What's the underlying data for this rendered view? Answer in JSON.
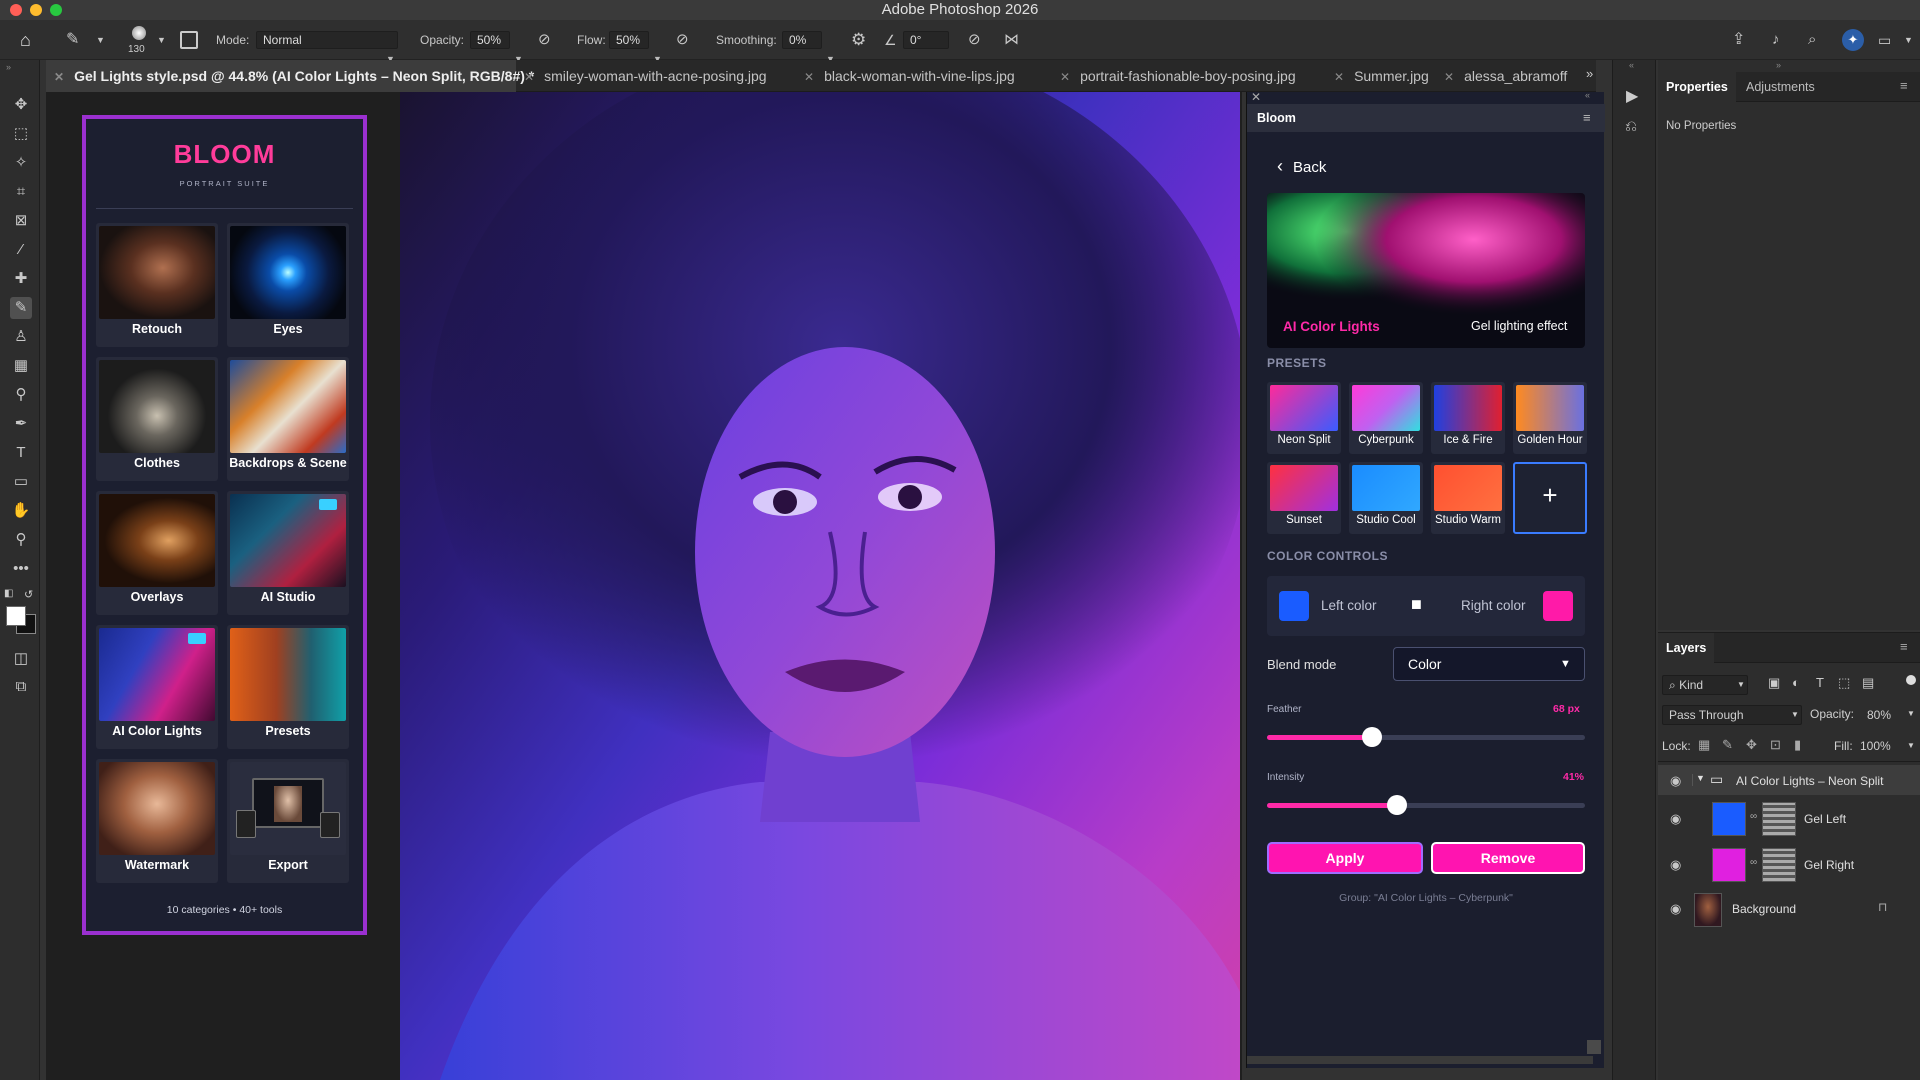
{
  "app": {
    "title": "Adobe Photoshop 2026"
  },
  "options_bar": {
    "brush_size": "130",
    "mode_label": "Mode:",
    "mode_value": "Normal",
    "opacity_label": "Opacity:",
    "opacity_value": "50%",
    "flow_label": "Flow:",
    "flow_value": "50%",
    "smoothing_label": "Smoothing:",
    "smoothing_value": "0%",
    "angle_value": "0°"
  },
  "tabs": [
    {
      "label": "Gel Lights style.psd @ 44.8% (AI Color Lights – Neon Split, RGB/8#) *"
    },
    {
      "label": "smiley-woman-with-acne-posing.jpg"
    },
    {
      "label": "black-woman-with-vine-lips.jpg"
    },
    {
      "label": "portrait-fashionable-boy-posing.jpg"
    },
    {
      "label": "Summer.jpg"
    },
    {
      "label": "alessa_abramoff"
    }
  ],
  "bloom_grid": {
    "logo": "BLOOM",
    "tagline": "PORTRAIT SUITE",
    "cards": [
      {
        "label": "Retouch"
      },
      {
        "label": "Eyes"
      },
      {
        "label": "Clothes"
      },
      {
        "label": "Backdrops & Scene"
      },
      {
        "label": "Overlays"
      },
      {
        "label": "AI Studio"
      },
      {
        "label": "AI Color Lights"
      },
      {
        "label": "Presets"
      },
      {
        "label": "Watermark"
      },
      {
        "label": "Export"
      }
    ],
    "footer": "10 categories • 40+ tools"
  },
  "plugin": {
    "header": "Bloom",
    "back": "Back",
    "hero_title": "AI Color Lights",
    "hero_sub": "Gel lighting effect",
    "presets_heading": "PRESETS",
    "presets": [
      {
        "label": "Neon Split"
      },
      {
        "label": "Cyberpunk"
      },
      {
        "label": "Ice & Fire"
      },
      {
        "label": "Golden Hour"
      },
      {
        "label": "Sunset"
      },
      {
        "label": "Studio Cool"
      },
      {
        "label": "Studio Warm"
      }
    ],
    "add_preset_symbol": "+",
    "color_controls_heading": "COLOR CONTROLS",
    "left_color_label": "Left color",
    "left_color": "#1a5cff",
    "right_color_label": "Right color",
    "right_color": "#ff1aa8",
    "blend_mode_label": "Blend mode",
    "blend_mode_value": "Color",
    "feather_label": "Feather",
    "feather_value": "68 px",
    "feather_fraction": 0.33,
    "intensity_label": "Intensity",
    "intensity_value": "41%",
    "intensity_fraction": 0.41,
    "apply_label": "Apply",
    "remove_label": "Remove",
    "group_note": "Group: \"AI Color Lights – Cyberpunk\""
  },
  "properties_panel": {
    "tab_properties": "Properties",
    "tab_adjustments": "Adjustments",
    "empty_text": "No Properties"
  },
  "layers_panel": {
    "title": "Layers",
    "kind_label": "Kind",
    "blend_value": "Pass Through",
    "opacity_label": "Opacity:",
    "opacity_value": "80%",
    "lock_label": "Lock:",
    "fill_label": "Fill:",
    "fill_value": "100%",
    "layers": [
      {
        "name": "AI Color Lights – Neon Split"
      },
      {
        "name": "Gel Left"
      },
      {
        "name": "Gel Right"
      },
      {
        "name": "Background"
      }
    ]
  },
  "colors": {
    "accent_magenta": "#ff1aa8",
    "accent_purple": "#9b30d0",
    "gel_blue": "#1a5cff"
  }
}
